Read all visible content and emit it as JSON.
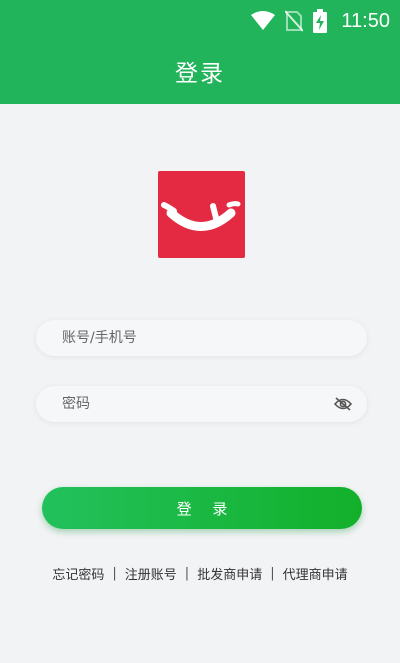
{
  "status_bar": {
    "time": "11:50",
    "icons": [
      "wifi-icon",
      "no-sim-icon",
      "battery-charging-icon"
    ]
  },
  "header": {
    "title": "登录"
  },
  "logo": {
    "icon": "smile-logo",
    "color": "#e42a42"
  },
  "form": {
    "account_placeholder": "账号/手机号",
    "account_value": "",
    "password_placeholder": "密码",
    "password_value": "",
    "password_toggle_icon": "eye-hidden-icon"
  },
  "login_button": {
    "label": "登 录"
  },
  "links": [
    {
      "label": "忘记密码"
    },
    {
      "label": "注册账号"
    },
    {
      "label": "批发商申请"
    },
    {
      "label": "代理商申请"
    }
  ],
  "separator": "|",
  "colors": {
    "primary": "#22b45a",
    "button_start": "#23c15c",
    "button_end": "#12b02a",
    "background": "#f2f3f5"
  }
}
